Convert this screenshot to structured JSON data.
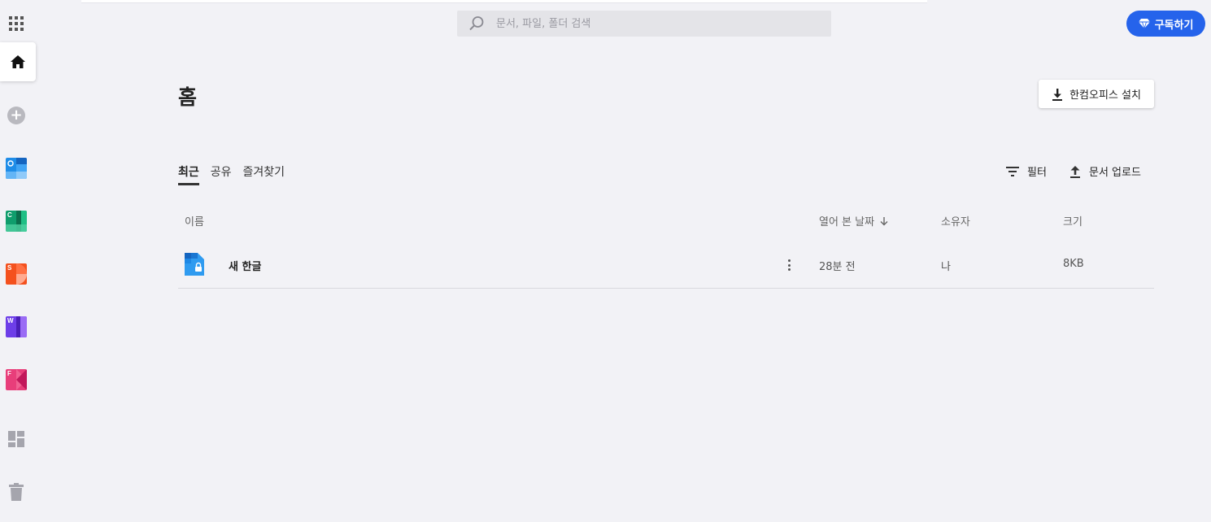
{
  "search": {
    "placeholder": "문서, 파일, 폴더 검색",
    "value": ""
  },
  "header": {
    "subscribe_label": "구독하기"
  },
  "sidebar": {
    "apps": [
      {
        "letter": "",
        "name": "hancom-docs-app"
      },
      {
        "letter": "C",
        "name": "hancell-app"
      },
      {
        "letter": "S",
        "name": "hanshow-app"
      },
      {
        "letter": "W",
        "name": "hanword-app"
      },
      {
        "letter": "F",
        "name": "hanpdf-app"
      }
    ]
  },
  "main": {
    "title": "홈",
    "install_label": "한컴오피스 설치",
    "tabs": [
      "최근",
      "공유",
      "즐겨찾기"
    ],
    "filter_label": "필터",
    "upload_label": "문서 업로드",
    "columns": {
      "name": "이름",
      "opened": "열어 본 날짜",
      "owner": "소유자",
      "size": "크기"
    },
    "files": [
      {
        "name": "새 한글",
        "opened": "28분 전",
        "owner": "나",
        "size": "8KB"
      }
    ]
  },
  "colors": {
    "accent": "#2563eb",
    "background": "#f2f2f6"
  }
}
